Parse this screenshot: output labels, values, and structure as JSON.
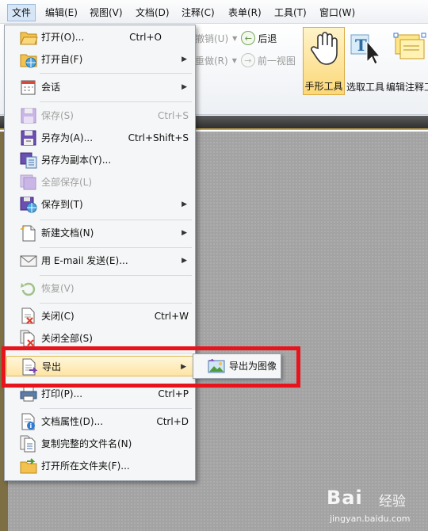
{
  "menubar": {
    "items": [
      "文件",
      "编辑(E)",
      "视图(V)",
      "文档(D)",
      "注释(C)",
      "表单(R)",
      "工具(T)",
      "窗口(W)"
    ]
  },
  "ribbon": {
    "undo_label": "撤销(U)",
    "back_label": "后退",
    "redo_label": "重做(R)",
    "prev_view_label": "前一视图",
    "hand_tool": "手形工具",
    "select_tool": "选取工具",
    "annot_tool": "编辑注释工"
  },
  "file_menu": {
    "open": {
      "label": "打开(O)...",
      "shortcut": "Ctrl+O"
    },
    "open_from": {
      "label": "打开自(F)"
    },
    "session": {
      "label": "会话"
    },
    "save": {
      "label": "保存(S)",
      "shortcut": "Ctrl+S"
    },
    "save_as": {
      "label": "另存为(A)...",
      "shortcut": "Ctrl+Shift+S"
    },
    "save_copy": {
      "label": "另存为副本(Y)..."
    },
    "save_all": {
      "label": "全部保存(L)"
    },
    "save_to": {
      "label": "保存到(T)"
    },
    "new_doc": {
      "label": "新建文档(N)"
    },
    "send_email": {
      "label": "用 E-mail 发送(E)..."
    },
    "revert": {
      "label": "恢复(V)"
    },
    "close": {
      "label": "关闭(C)",
      "shortcut": "Ctrl+W"
    },
    "close_all": {
      "label": "关闭全部(S)"
    },
    "export": {
      "label": "导出"
    },
    "print": {
      "label": "打印(P)...",
      "shortcut": "Ctrl+P"
    },
    "doc_props": {
      "label": "文档属性(D)...",
      "shortcut": "Ctrl+D"
    },
    "copy_filename": {
      "label": "复制完整的文件名(N)"
    },
    "open_folder": {
      "label": "打开所在文件夹(F)..."
    }
  },
  "export_submenu": {
    "export_image": "导出为图像"
  },
  "watermark": {
    "logo": "Bai",
    "text": "经验",
    "url": "jingyan.baidu.com"
  }
}
